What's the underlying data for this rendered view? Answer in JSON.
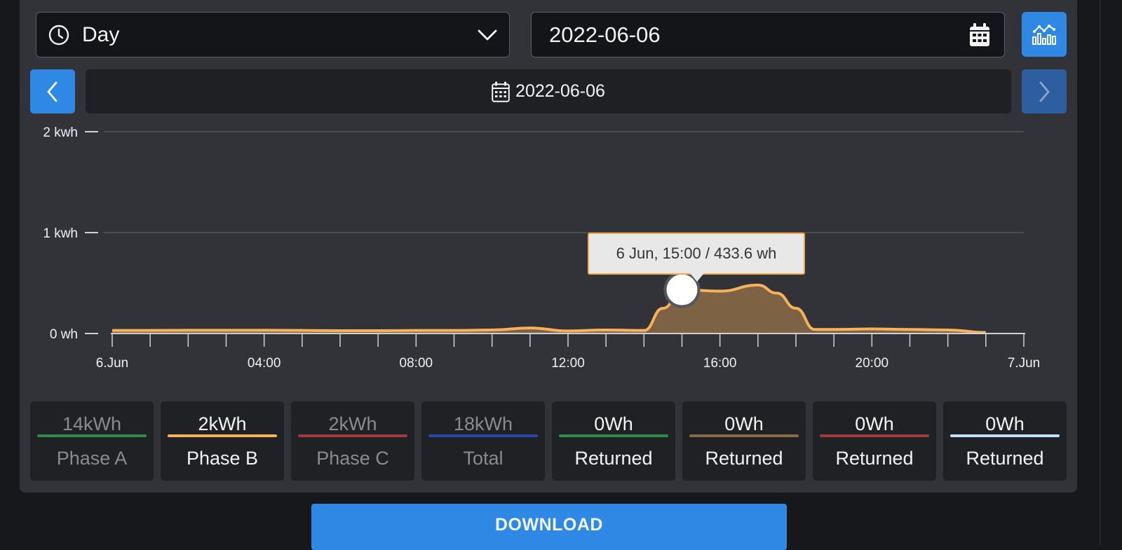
{
  "period_select": {
    "value": "Day",
    "icon": "clock-icon"
  },
  "date_input": {
    "value": "2022-06-06",
    "icon": "calendar-icon"
  },
  "chart_toggle": {
    "icon": "chart-icon"
  },
  "date_nav": {
    "label": "2022-06-06",
    "prev_icon": "chevron-left-icon",
    "next_icon": "chevron-right-icon"
  },
  "tooltip": {
    "text": "6 Jun, 15:00 / 433.6 wh"
  },
  "legend": [
    {
      "value": "14kWh",
      "name": "Phase A",
      "color": "#2f8a4a",
      "active": false
    },
    {
      "value": "2kWh",
      "name": "Phase B",
      "color": "#f7b15a",
      "active": true
    },
    {
      "value": "2kWh",
      "name": "Phase C",
      "color": "#a23a3a",
      "active": false
    },
    {
      "value": "18kWh",
      "name": "Total",
      "color": "#2748a8",
      "active": false
    },
    {
      "value": "0Wh",
      "name": "Returned",
      "color": "#2f8a4a",
      "active": true
    },
    {
      "value": "0Wh",
      "name": "Returned",
      "color": "#8a6a44",
      "active": true
    },
    {
      "value": "0Wh",
      "name": "Returned",
      "color": "#a23a3a",
      "active": true
    },
    {
      "value": "0Wh",
      "name": "Returned",
      "color": "#bfe0ff",
      "active": true
    }
  ],
  "download_label": "DOWNLOAD",
  "chart_data": {
    "type": "area",
    "y_ticks": [
      "2 kwh",
      "1 kwh",
      "0 wh"
    ],
    "x_ticks": [
      "6.Jun",
      "04:00",
      "08:00",
      "12:00",
      "16:00",
      "20:00",
      "7.Jun"
    ],
    "ylim": [
      0,
      2000
    ],
    "series": [
      {
        "name": "Phase B",
        "color": "#f7b15a",
        "x": [
          0,
          1,
          2,
          3,
          4,
          5,
          6,
          7,
          8,
          9,
          10,
          11,
          12,
          13,
          14,
          14.5,
          15,
          16,
          17,
          17.5,
          18,
          18.5,
          19,
          20,
          21,
          22,
          23
        ],
        "y": [
          30,
          30,
          32,
          32,
          32,
          30,
          28,
          28,
          30,
          30,
          35,
          55,
          25,
          35,
          30,
          250,
          433.6,
          420,
          480,
          400,
          250,
          40,
          40,
          45,
          40,
          35,
          10
        ]
      }
    ],
    "highlight": {
      "x": 15,
      "y": 433.6
    }
  }
}
